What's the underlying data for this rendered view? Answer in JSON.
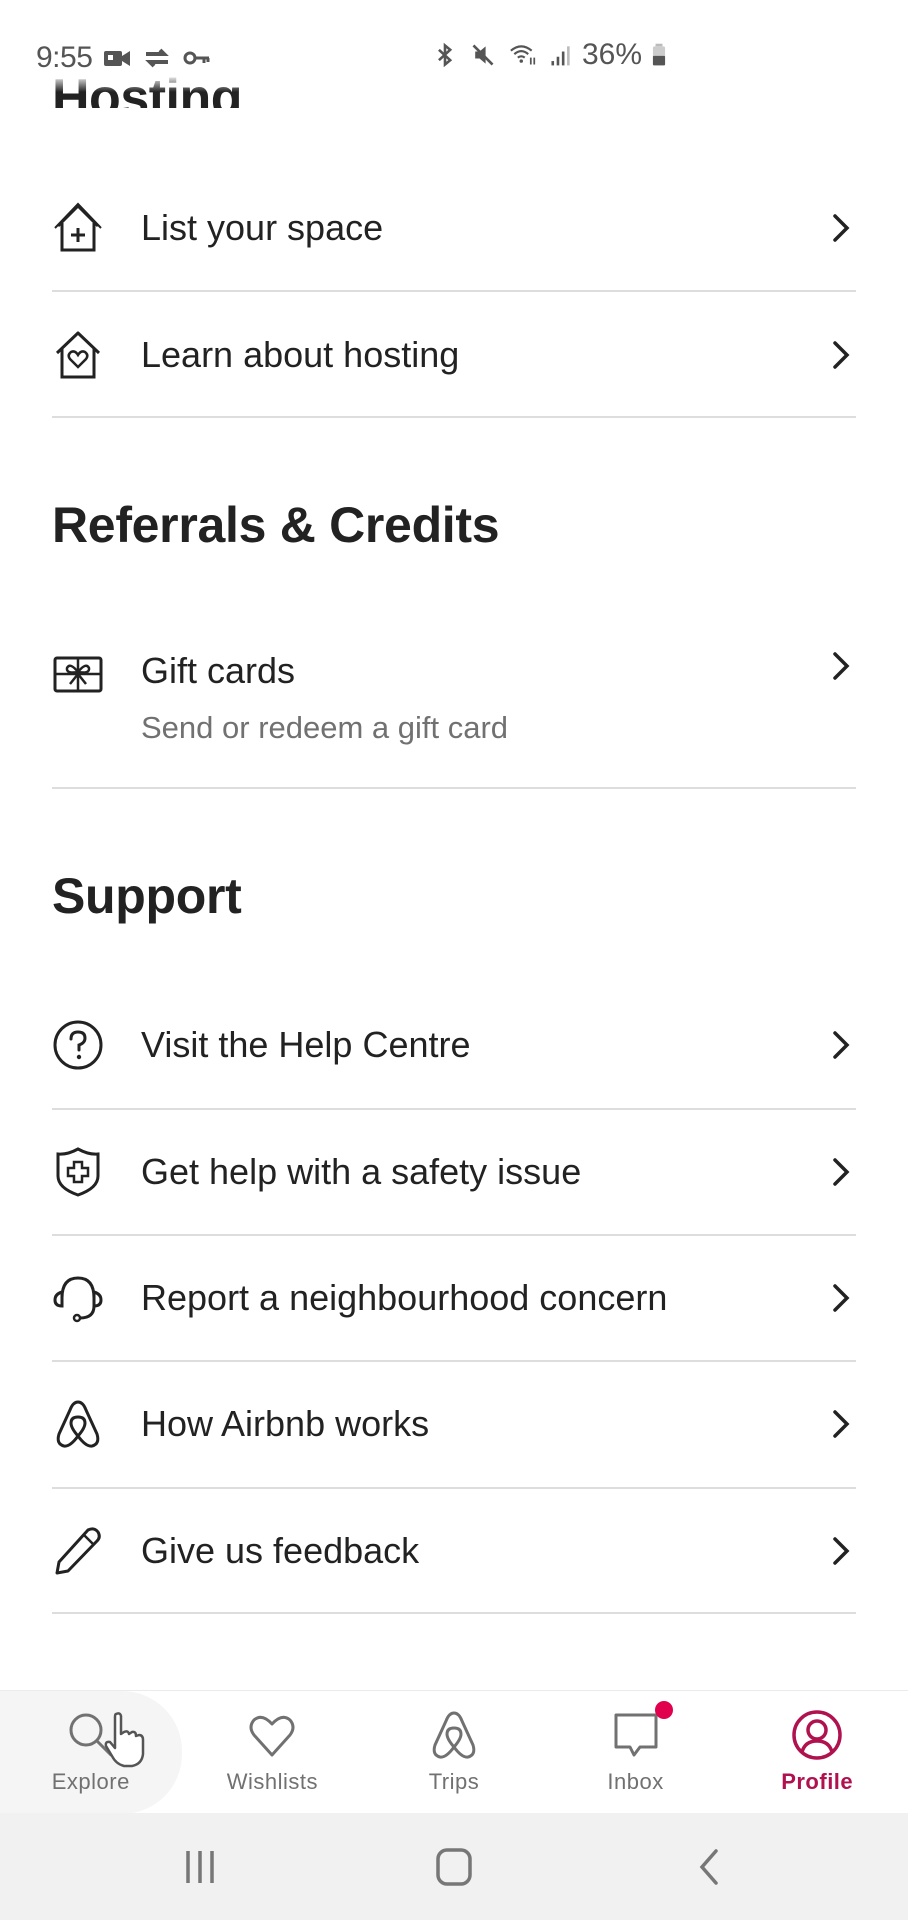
{
  "status_bar": {
    "time": "9:55",
    "left_icons": [
      "video-camera-icon",
      "sync-icon",
      "key-icon"
    ],
    "right_icons": [
      "bluetooth-icon",
      "mute-icon",
      "wifi-icon",
      "signal-icon"
    ],
    "battery": "36%"
  },
  "clipped_heading": "Hosting",
  "sections": {
    "hosting": {
      "items": [
        {
          "icon": "house-plus-icon",
          "label": "List your space"
        },
        {
          "icon": "house-heart-icon",
          "label": "Learn about hosting"
        }
      ]
    },
    "referrals": {
      "title": "Referrals & Credits",
      "items": [
        {
          "icon": "gift-card-icon",
          "label": "Gift cards",
          "sublabel": "Send or redeem a gift card"
        }
      ]
    },
    "support": {
      "title": "Support",
      "items": [
        {
          "icon": "question-circle-icon",
          "label": "Visit the Help Centre"
        },
        {
          "icon": "shield-cross-icon",
          "label": "Get help with a safety issue"
        },
        {
          "icon": "headset-icon",
          "label": "Report a neighbourhood concern"
        },
        {
          "icon": "airbnb-logo-icon",
          "label": "How Airbnb works"
        },
        {
          "icon": "pencil-icon",
          "label": "Give us feedback"
        }
      ]
    }
  },
  "bottom_nav": {
    "items": [
      {
        "icon": "search-icon",
        "label": "Explore",
        "active": false
      },
      {
        "icon": "heart-icon",
        "label": "Wishlists",
        "active": false
      },
      {
        "icon": "airbnb-logo-icon",
        "label": "Trips",
        "active": false
      },
      {
        "icon": "chat-icon",
        "label": "Inbox",
        "active": false,
        "badge": true
      },
      {
        "icon": "profile-icon",
        "label": "Profile",
        "active": true
      }
    ],
    "active_color": "#b0124f",
    "badge_color": "#e0004d"
  },
  "system_nav": {
    "buttons": [
      "recents-button",
      "home-button",
      "back-button"
    ]
  }
}
